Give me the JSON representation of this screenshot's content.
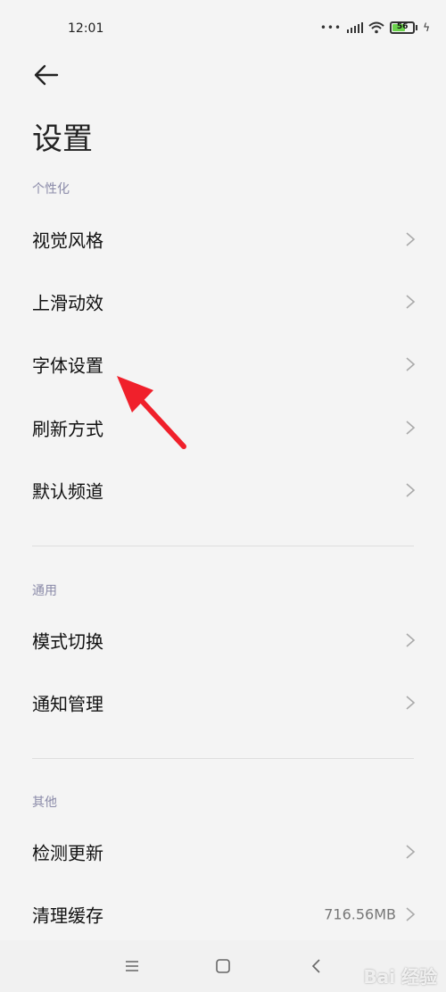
{
  "status_bar": {
    "time": "12:01",
    "battery_level": "56",
    "icons": [
      "dots-icon",
      "signal-icon",
      "wifi-icon",
      "battery-icon",
      "charging-icon"
    ]
  },
  "header": {
    "title": "设置"
  },
  "sections": [
    {
      "label": "个性化",
      "items": [
        {
          "label": "视觉风格"
        },
        {
          "label": "上滑动效"
        },
        {
          "label": "字体设置"
        },
        {
          "label": "刷新方式"
        },
        {
          "label": "默认频道"
        }
      ]
    },
    {
      "label": "通用",
      "items": [
        {
          "label": "模式切换"
        },
        {
          "label": "通知管理"
        }
      ]
    },
    {
      "label": "其他",
      "items": [
        {
          "label": "检测更新"
        },
        {
          "label": "清理缓存",
          "value": "716.56MB"
        }
      ]
    }
  ],
  "annotation": {
    "color": "#f0202b",
    "points_to": "字体设置"
  },
  "watermark": "Bai 经验",
  "colors": {
    "background": "#f4f4f4",
    "section_label": "#8a8aa8",
    "battery_fill": "#6ad24b"
  }
}
